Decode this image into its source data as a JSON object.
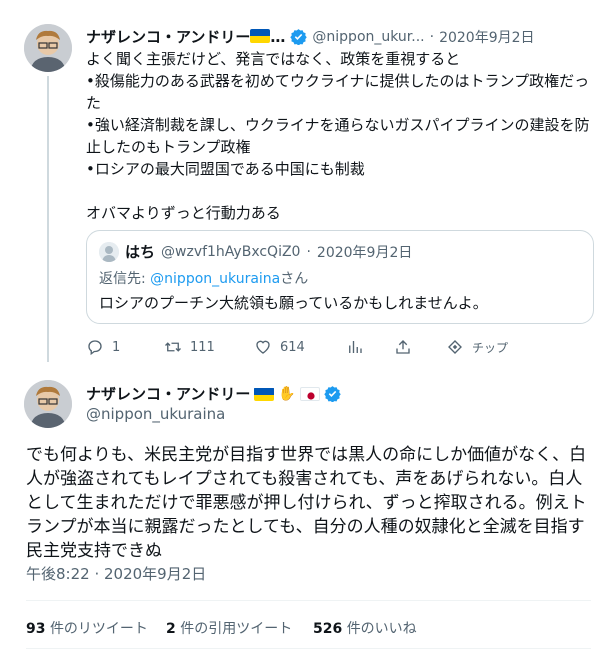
{
  "tweet1": {
    "author_name": "ナザレンコ・アンドリー",
    "author_name_truncation": "…",
    "handle": "@nippon_ukur...",
    "separator": "·",
    "date": "2020年9月2日",
    "text": "よく聞く主張だけど、発言ではなく、政策を重視すると\n•殺傷能力のある武器を初めてウクライナに提供したのはトランプ政権だった\n•強い経済制裁を課し、ウクライナを通らないガスパイプラインの建設を防止したのもトランプ政権\n•ロシアの最大同盟国である中国にも制裁\n\nオバマよりずっと行動力ある",
    "quote": {
      "author_name": "はち",
      "handle": "@wzvf1hAyBxcQiZ0",
      "separator": "·",
      "date": "2020年9月2日",
      "reply_label": "返信先:",
      "reply_handle": "@nippon_ukuraina",
      "reply_suffix": "さん",
      "text": "ロシアのプーチン大統領も願っているかもしれませんよ。"
    },
    "actions": {
      "replies": "1",
      "retweets": "111",
      "likes": "614",
      "tip_label": "チップ"
    }
  },
  "tweet2": {
    "author_name": "ナザレンコ・アンドリー",
    "handle": "@nippon_ukuraina",
    "text": "でも何よりも、米民主党が目指す世界では黒人の命にしか価値がなく、白人が強盗されてもレイプされても殺害されても、声をあげられない。白人として生まれただけで罪悪感が押し付けられ、ずっと搾取される。例えトランプが本当に親露だったとしても、自分の人種の奴隷化と全滅を目指す民主党支持できぬ",
    "timestamp": "午後8:22 · 2020年9月2日",
    "stats": {
      "retweets_count": "93",
      "retweets_label": "件のリツイート",
      "quotes_count": "2",
      "quotes_label": "件の引用ツイート",
      "likes_count": "526",
      "likes_label": "件のいいね"
    }
  },
  "colors": {
    "text": "#0f1419",
    "muted": "#536471",
    "verified": "#1d9bf0",
    "border": "#cfd9de",
    "flag_blue": "#0057b7",
    "flag_yellow": "#ffd700",
    "japan_red": "#bc002d"
  }
}
